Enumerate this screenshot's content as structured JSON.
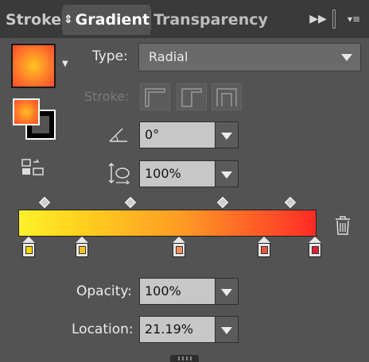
{
  "tabs": [
    {
      "label": "Stroke"
    },
    {
      "label": "Gradient"
    },
    {
      "label": "Transparency"
    }
  ],
  "gradient": {
    "type_label": "Type:",
    "type_value": "Radial",
    "stroke_label": "Stroke:",
    "angle_value": "0°",
    "aspect_value": "100%",
    "opacity_label": "Opacity:",
    "opacity_value": "100%",
    "location_label": "Location:",
    "location_value": "21.19%"
  },
  "stops": [
    {
      "color": "#f5d400"
    },
    {
      "color": "#ffc020"
    },
    {
      "color": "#f0905a"
    },
    {
      "color": "#e85540"
    },
    {
      "color": "#e02030"
    }
  ],
  "colors": {
    "panel_bg": "#535353",
    "tabstrip_bg": "#3a3a3a",
    "field_bg": "#c7c7c7"
  }
}
